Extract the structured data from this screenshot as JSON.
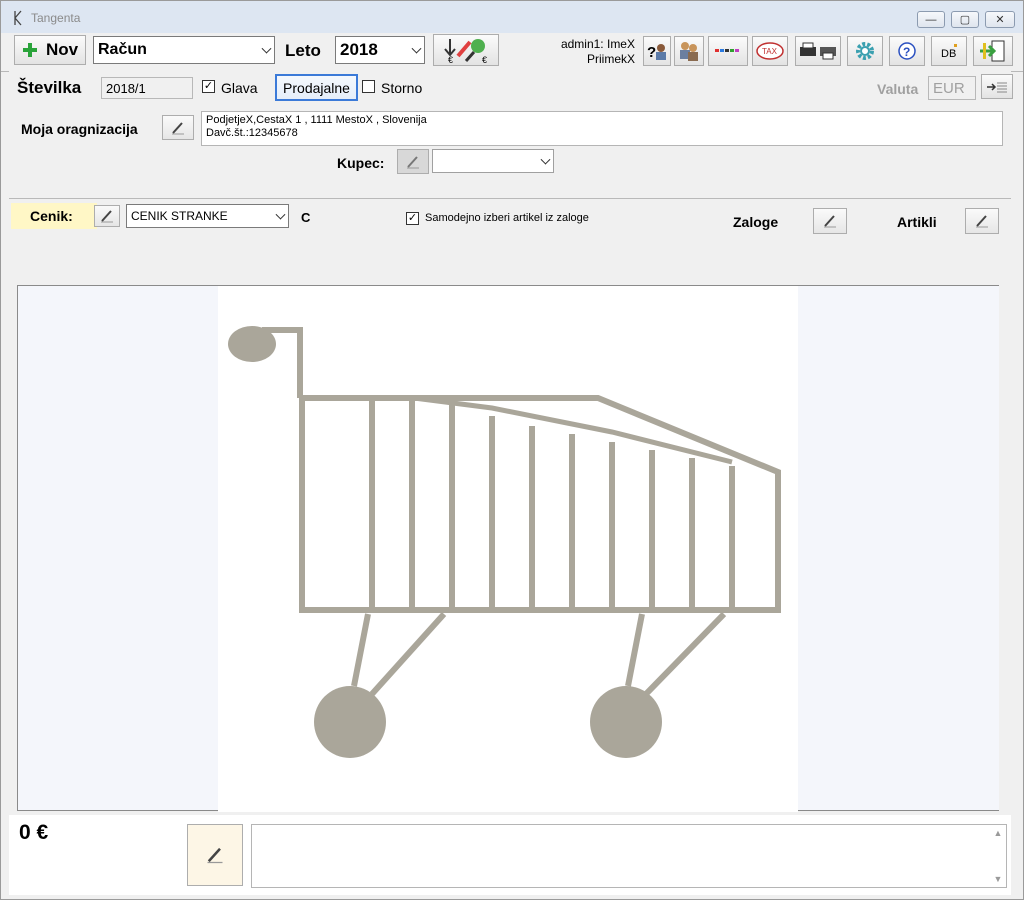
{
  "window": {
    "title": "Tangenta",
    "minimize": "—",
    "maximize": "▢",
    "close": "✕"
  },
  "toolbar": {
    "new_label": "Nov",
    "doc_type": "Račun",
    "year_label": "Leto",
    "year_value": "2018",
    "user_line1": "admin1: ImeX",
    "user_line2": "PriimekX",
    "icons": [
      "currency-exchange-icon",
      "help-user-icon",
      "users-icon",
      "barcode-icon",
      "tax-icon",
      "printer-icon",
      "settings-icon",
      "help-icon",
      "database-icon",
      "exit-icon"
    ]
  },
  "header": {
    "number_label": "Številka",
    "number_value": "2018/1",
    "glava_label": "Glava",
    "glava_checked": true,
    "prodajalne_label": "Prodajalne",
    "storno_label": "Storno",
    "storno_checked": false,
    "valuta_label": "Valuta",
    "valuta_value": "EUR",
    "org_label": "Moja oragnizacija",
    "org_line1": "PodjetjeX,CestaX 1 , 1111 MestoX , Slovenija",
    "org_line2": "Davč.št.:12345678",
    "kupec_label": "Kupec:",
    "kupec_value": ""
  },
  "pricelist": {
    "label": "Cenik:",
    "value": "CENIK STRANKE",
    "code": "C",
    "auto_select_label": "Samodejno izberi artikel iz zaloge",
    "auto_select_checked": true,
    "zaloge_label": "Zaloge",
    "artikli_label": "Artikli"
  },
  "footer": {
    "total": "0 €",
    "note": ""
  },
  "colors": {
    "cart": "#aaa69a",
    "cenik_bg": "#fff7c6",
    "accent_green": "#2aa33a"
  }
}
